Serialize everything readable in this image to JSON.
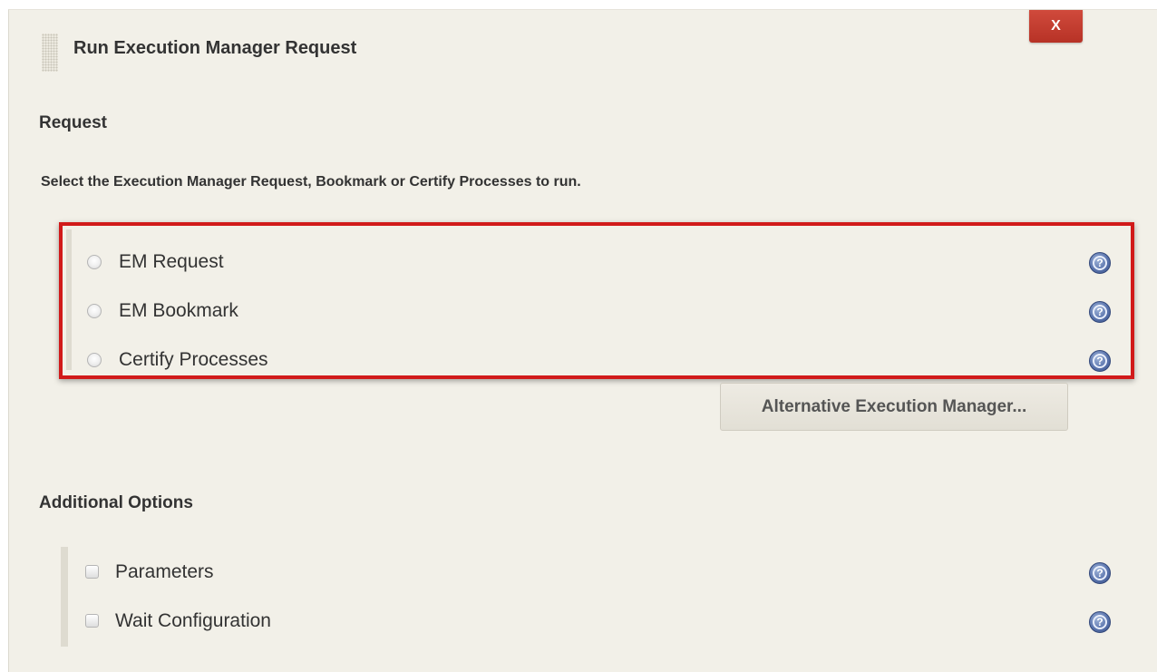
{
  "dialog": {
    "title": "Run Execution Manager Request",
    "close_label": "X"
  },
  "request_section": {
    "heading": "Request",
    "description": "Select the Execution Manager Request, Bookmark or Certify Processes to run.",
    "options": [
      {
        "label": "EM Request",
        "selected": false
      },
      {
        "label": "EM Bookmark",
        "selected": false
      },
      {
        "label": "Certify Processes",
        "selected": false
      }
    ],
    "alt_button_label": "Alternative Execution Manager..."
  },
  "additional_section": {
    "heading": "Additional Options",
    "options": [
      {
        "label": "Parameters",
        "checked": false
      },
      {
        "label": "Wait Configuration",
        "checked": false
      }
    ]
  },
  "help_icon_glyph": "?",
  "colors": {
    "panel_bg": "#f2f0e8",
    "close_button": "#c0392b",
    "highlight_border": "#d11a1a",
    "help_icon": "#5a74ad"
  }
}
